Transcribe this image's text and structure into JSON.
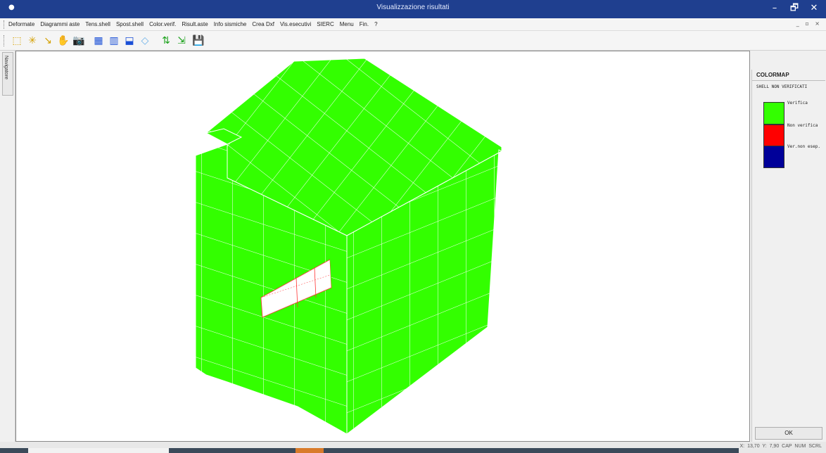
{
  "window": {
    "title": "Visualizzazione risultati",
    "minimize": "–",
    "restore": "🗗",
    "close": "✕"
  },
  "menu": {
    "items": [
      "Deformate",
      "Diagrammi aste",
      "Tens.shell",
      "Spost.shell",
      "Color.verif.",
      "Risult.aste",
      "Info sismiche",
      "Crea Dxf",
      "Vis.esecutivi",
      "SIERC",
      "Menu",
      "Fin.",
      "?"
    ],
    "mdi_controls": "_ ▫ ×"
  },
  "toolbar": {
    "buttons": [
      {
        "name": "zoom-window-icon",
        "glyph": "⬚"
      },
      {
        "name": "zoom-all-icon",
        "glyph": "✳"
      },
      {
        "name": "zoom-extents-icon",
        "glyph": "↘"
      },
      {
        "name": "pan-icon",
        "glyph": "✋"
      },
      {
        "name": "camera-icon",
        "glyph": "📷"
      },
      {
        "name": "view-front-icon",
        "glyph": "▦"
      },
      {
        "name": "view-side-icon",
        "glyph": "▥"
      },
      {
        "name": "view-3d-icon",
        "glyph": "⬓"
      },
      {
        "name": "off-view-icon",
        "glyph": "◇"
      },
      {
        "name": "scale-icon",
        "glyph": "⇅"
      },
      {
        "name": "export-icon",
        "glyph": "⇲"
      },
      {
        "name": "save-icon",
        "glyph": "💾"
      }
    ]
  },
  "navigator": {
    "tab_label": "Navigatore"
  },
  "colormap": {
    "title": "COLORMAP",
    "subtitle": "SHELL NON VERIFICATI",
    "entries": [
      {
        "label": "Verifica",
        "color": "#33ff00"
      },
      {
        "label": "Non verifica",
        "color": "#ff0000"
      },
      {
        "label": "Ver.non esep.",
        "color": "#000099"
      }
    ],
    "ok_label": "OK"
  },
  "model": {
    "shell_ok_color": "#33ff00",
    "opening_edge_color": "#ff0000"
  },
  "status": {
    "coords": "X: 13,70 Y: 7,90",
    "cap": "CAP",
    "num": "NUM",
    "scrl": "SCRL"
  },
  "colors": {
    "titlebar": "#1f3f8f"
  }
}
